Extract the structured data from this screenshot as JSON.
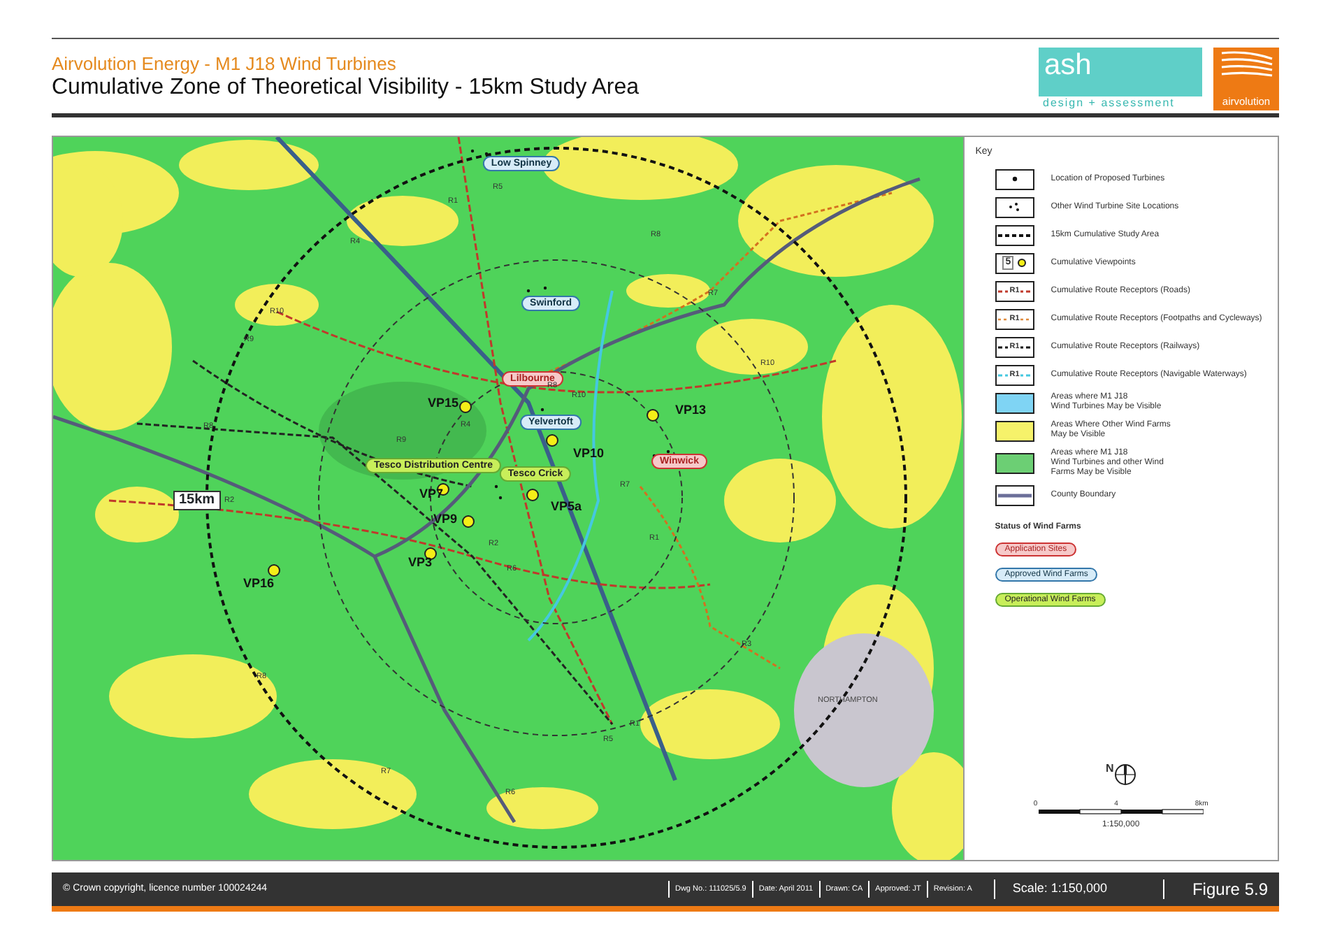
{
  "header": {
    "subtitle": "Airvolution Energy - M1 J18 Wind Turbines",
    "title": "Cumulative Zone of Theoretical Visibility - 15km Study Area"
  },
  "logos": {
    "ash": "ash",
    "ash_tagline": "design + assessment",
    "airvolution": "airvolution"
  },
  "map": {
    "places": [
      {
        "name": "Low Spinney",
        "kind": "approved"
      },
      {
        "name": "Swinford",
        "kind": "approved"
      },
      {
        "name": "Lilbourne",
        "kind": "application"
      },
      {
        "name": "Yelvertoft",
        "kind": "approved"
      },
      {
        "name": "Winwick",
        "kind": "application"
      },
      {
        "name": "Tesco Distribution Centre",
        "kind": "operational"
      },
      {
        "name": "Tesco Crick",
        "kind": "operational"
      }
    ],
    "viewpoints": [
      "VP15",
      "VP13",
      "VP10",
      "VP7",
      "VP5a",
      "VP9",
      "VP3",
      "VP16"
    ],
    "radius_label": "15km",
    "routes": [
      "R4",
      "R1",
      "R5",
      "R10",
      "R9",
      "R8",
      "R7",
      "R10",
      "R10",
      "R8",
      "R4",
      "R9",
      "R8",
      "R2",
      "R7",
      "R1",
      "R3",
      "R8",
      "R7",
      "R6",
      "R1",
      "R5",
      "R2",
      "R6"
    ],
    "town": "NORTHAMPTON"
  },
  "key": {
    "title": "Key",
    "items": [
      {
        "kind": "turbine",
        "label": "Location of Proposed Turbines"
      },
      {
        "kind": "other-sites",
        "label": "Other Wind Turbine Site Locations"
      },
      {
        "kind": "study-area",
        "label": "15km Cumulative Study Area"
      },
      {
        "kind": "viewpoint",
        "symbol": "5",
        "label": "Cumulative Viewpoints"
      },
      {
        "kind": "road",
        "symbol": "R1",
        "label": "Cumulative Route Receptors (Roads)"
      },
      {
        "kind": "footpath",
        "symbol": "R1",
        "label": "Cumulative Route Receptors (Footpaths and Cycleways)"
      },
      {
        "kind": "railway",
        "symbol": "R1",
        "label": "Cumulative Route Receptors (Railways)"
      },
      {
        "kind": "waterway",
        "symbol": "R1",
        "label": "Cumulative Route Receptors (Navigable Waterways)"
      },
      {
        "kind": "area-blue",
        "label": "Areas where M1 J18\nWind Turbines May be Visible"
      },
      {
        "kind": "area-yellow",
        "label": "Areas Where Other Wind Farms\nMay be Visible"
      },
      {
        "kind": "area-green",
        "label": "Areas where M1 J18\nWind Turbines and other Wind\nFarms May be Visible"
      },
      {
        "kind": "county",
        "label": "County Boundary"
      }
    ],
    "status_title": "Status of Wind Farms",
    "statuses": [
      {
        "kind": "application",
        "label": "Application Sites"
      },
      {
        "kind": "approved",
        "label": "Approved Wind Farms"
      },
      {
        "kind": "operational",
        "label": "Operational Wind Farms"
      }
    ],
    "north": "N",
    "scale_ticks": [
      "0",
      "4",
      "8km"
    ],
    "scale_text": "1:150,000"
  },
  "footer": {
    "copyright": "© Crown copyright, licence number 100024244",
    "fields": [
      "Dwg No.: 111025/5.9",
      "Date: April 2011",
      "Drawn: CA",
      "Approved: JT",
      "Revision: A"
    ],
    "scale": "Scale: 1:150,000",
    "figure": "Figure 5.9"
  }
}
